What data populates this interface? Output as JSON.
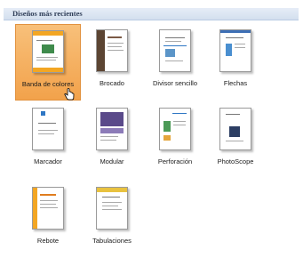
{
  "section": {
    "title": "Diseños más recientes"
  },
  "templates": [
    {
      "name": "Banda de colores",
      "selected": true
    },
    {
      "name": "Brocado",
      "selected": false
    },
    {
      "name": "Divisor sencillo",
      "selected": false
    },
    {
      "name": "Flechas",
      "selected": false
    },
    {
      "name": "Marcador",
      "selected": false
    },
    {
      "name": "Modular",
      "selected": false
    },
    {
      "name": "Perforación",
      "selected": false
    },
    {
      "name": "PhotoScope",
      "selected": false
    },
    {
      "name": "Rebote",
      "selected": false
    },
    {
      "name": "Tabulaciones",
      "selected": false
    }
  ],
  "colors": {
    "selected_tile": "#f2a24b",
    "header": "#d3dfee",
    "accent_blue": "#2f77c4",
    "accent_orange": "#f3a623",
    "accent_purple": "#5a4a8a"
  }
}
